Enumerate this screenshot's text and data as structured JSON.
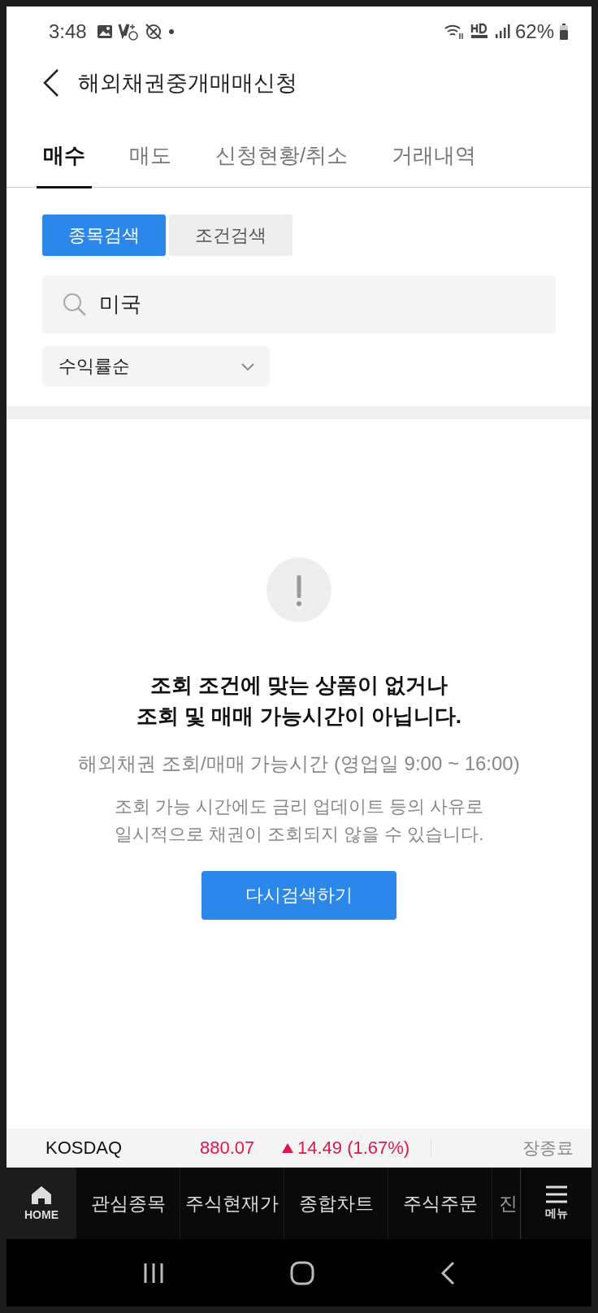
{
  "status_bar": {
    "time": "3:48",
    "battery": "62%"
  },
  "header": {
    "title": "해외채권중개매매신청"
  },
  "tabs": [
    {
      "label": "매수",
      "selected": true
    },
    {
      "label": "매도",
      "selected": false
    },
    {
      "label": "신청현황/취소",
      "selected": false
    },
    {
      "label": "거래내역",
      "selected": false
    }
  ],
  "search_modes": [
    {
      "label": "종목검색",
      "selected": true
    },
    {
      "label": "조건검색",
      "selected": false
    }
  ],
  "search": {
    "value": "미국"
  },
  "sort": {
    "value": "수익률순"
  },
  "empty_state": {
    "headline": [
      "조회 조건에 맞는 상품이 없거나",
      "조회 및 매매 가능시간이 아닙니다."
    ],
    "hours": "해외채권 조회/매매 가능시간 (영업일 9:00 ~ 16:00)",
    "note": [
      "조회 가능 시간에도 금리 업데이트 등의 사유로",
      "일시적으로 채권이 조회되지 않을 수 있습니다."
    ],
    "button": "다시검색하기"
  },
  "ticker": {
    "name": "KOSDAQ",
    "price": "880.07",
    "change": "14.49 (1.67%)",
    "rising": true,
    "status": "장종료"
  },
  "bottom_nav": {
    "home": "HOME",
    "items": [
      "관심종목",
      "주식현재가",
      "종합차트",
      "주식주문",
      "진"
    ],
    "menu": "메뉴"
  }
}
